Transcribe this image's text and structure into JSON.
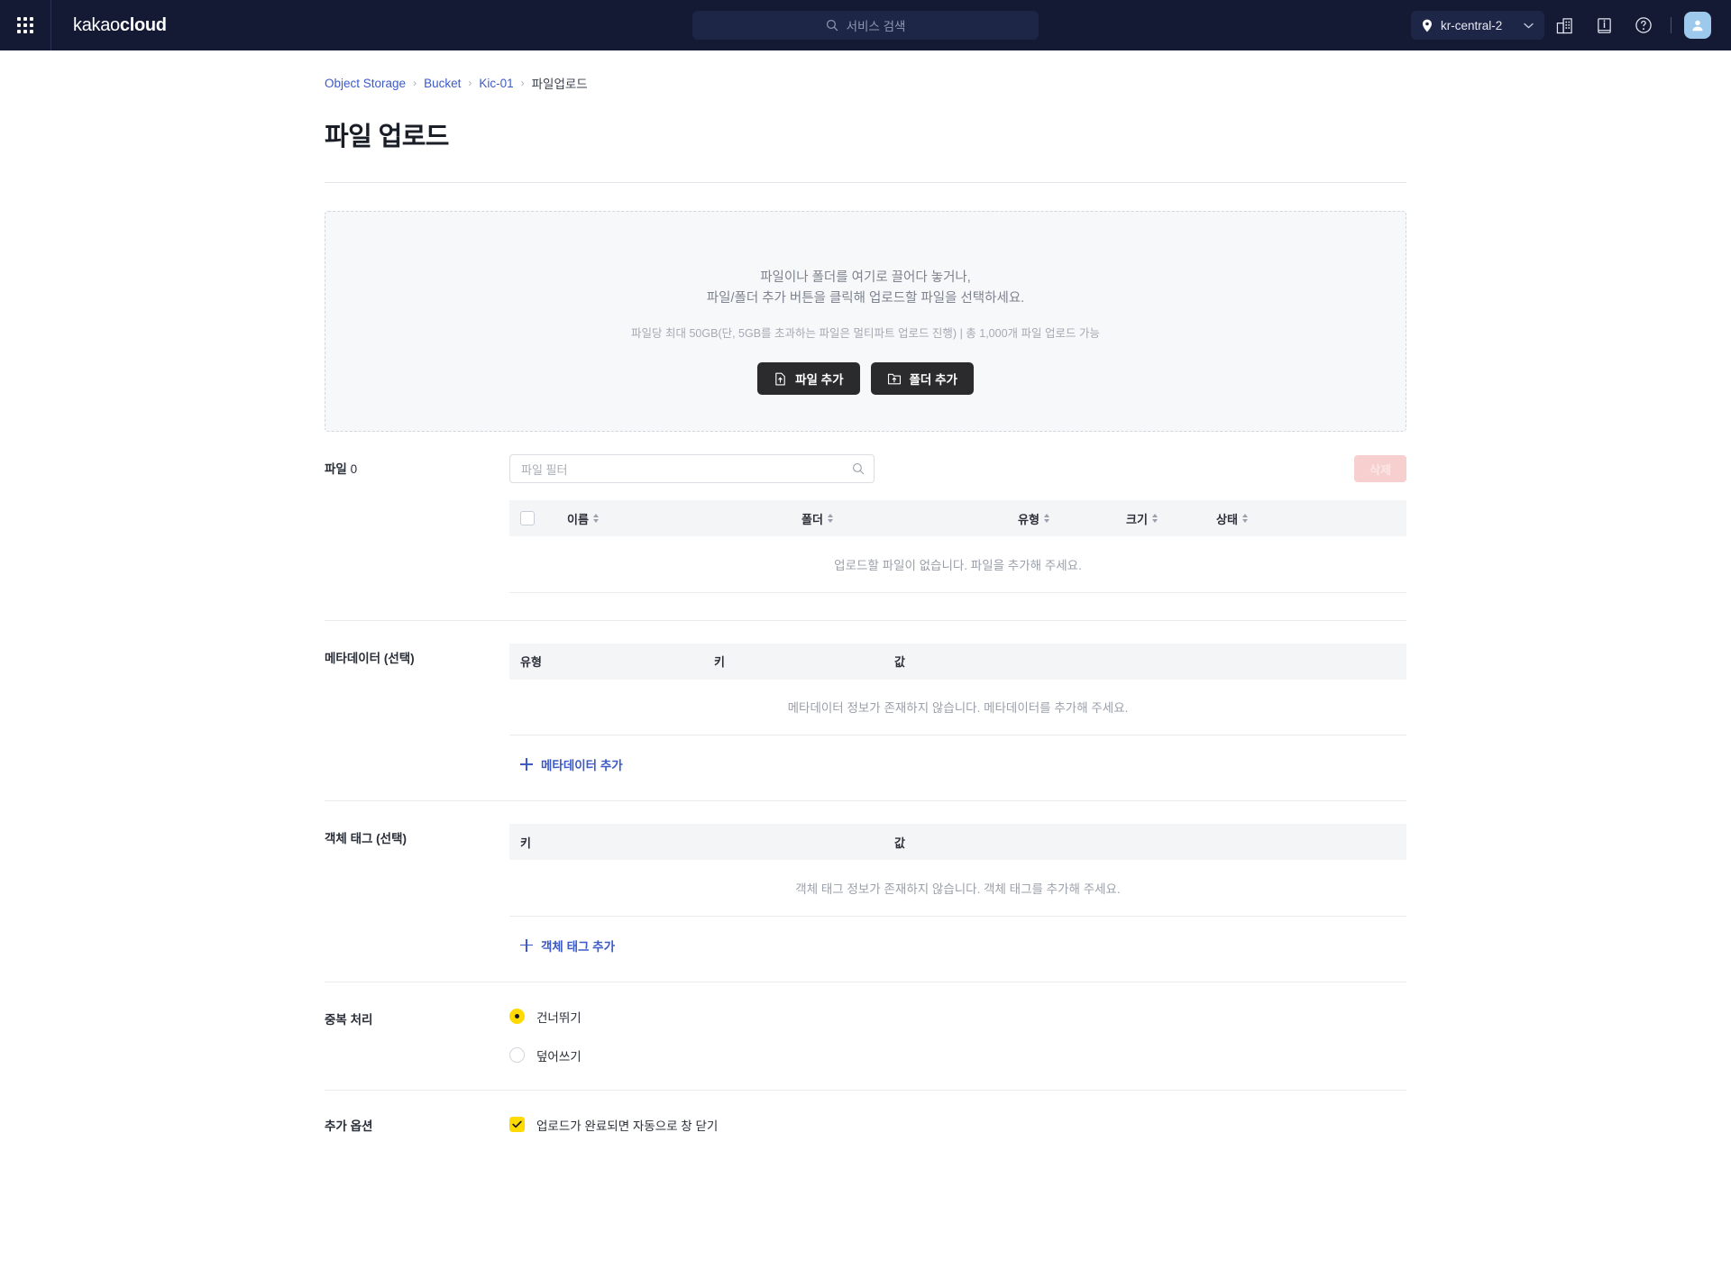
{
  "topbar": {
    "apps_icon": "grid-apps-icon",
    "brand_light": "kakao",
    "brand_bold": "cloud",
    "search_placeholder": "서비스 검색",
    "search_icon": "search-icon",
    "region": "kr-central-2",
    "region_icon": "location-pin-icon",
    "chevron_icon": "chevron-down-icon",
    "icons": [
      "org-building-icon",
      "docs-book-icon",
      "help-question-icon"
    ],
    "avatar_icon": "user-avatar-icon"
  },
  "breadcrumb": {
    "items": [
      {
        "label": "Object Storage",
        "link": true
      },
      {
        "label": "Bucket",
        "link": true
      },
      {
        "label": "Kic-01",
        "link": true
      },
      {
        "label": "파일업로드",
        "link": false
      }
    ],
    "separator": "›"
  },
  "page": {
    "title": "파일 업로드"
  },
  "dropzone": {
    "line1": "파일이나 폴더를 여기로 끌어다 놓거나,",
    "line2": "파일/폴더 추가 버튼을 클릭해 업로드할 파일을 선택하세요.",
    "note": "파일당 최대 50GB(단, 5GB를 초과하는 파일은 멀티파트 업로드 진행) | 총 1,000개 파일 업로드 가능",
    "add_file_label": "파일 추가",
    "add_file_icon": "file-upload-icon",
    "add_folder_label": "폴더 추가",
    "add_folder_icon": "folder-upload-icon"
  },
  "files": {
    "label": "파일",
    "count": "0",
    "filter_placeholder": "파일 필터",
    "filter_icon": "search-icon",
    "delete_label": "삭제",
    "columns": [
      "이름",
      "폴더",
      "유형",
      "크기",
      "상태"
    ],
    "empty_text": "업로드할 파일이 없습니다. 파일을 추가해 주세요."
  },
  "metadata": {
    "label": "메타데이터 (선택)",
    "columns": [
      "유형",
      "키",
      "값"
    ],
    "empty_text": "메타데이터 정보가 존재하지 않습니다. 메타데이터를 추가해 주세요.",
    "add_label": "메타데이터 추가",
    "add_icon": "plus-icon"
  },
  "object_tags": {
    "label": "객체 태그 (선택)",
    "columns": [
      "키",
      "값"
    ],
    "empty_text": "객체 태그 정보가 존재하지 않습니다. 객체 태그를 추가해 주세요.",
    "add_label": "객체 태그 추가",
    "add_icon": "plus-icon"
  },
  "duplicate": {
    "label": "중복 처리",
    "options": [
      {
        "label": "건너뛰기",
        "selected": true
      },
      {
        "label": "덮어쓰기",
        "selected": false
      }
    ]
  },
  "extra": {
    "label": "추가 옵션",
    "checkbox_label": "업로드가 완료되면 자동으로 창 닫기",
    "checked": true
  },
  "colors": {
    "brand_yellow": "#FFDA00",
    "topbar_bg": "#141A33",
    "link_blue": "#3C5AC8",
    "danger_disabled": "#F8CFCF"
  }
}
